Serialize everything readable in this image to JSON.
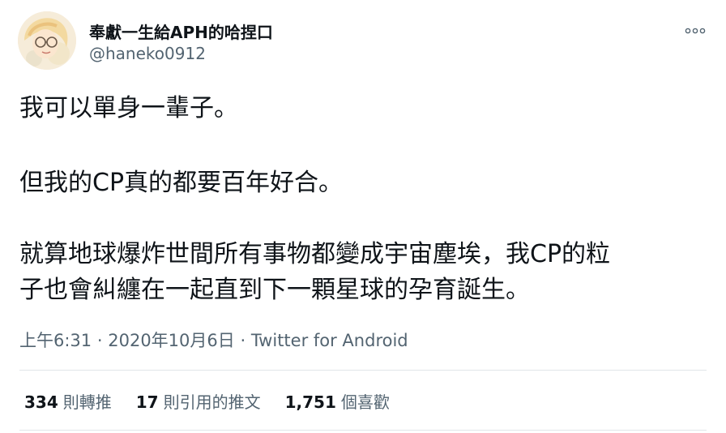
{
  "author": {
    "display_name": "奉獻一生給APH的哈捏口",
    "handle": "@haneko0912"
  },
  "header": {
    "more_icon": "more-horizontal-icon"
  },
  "tweet": {
    "lines": [
      "我可以單身一輩子。",
      "但我的CP真的都要百年好合。",
      "就算地球爆炸世間所有事物都變成宇宙塵埃，我CP的粒",
      "子也會糾纏在一起直到下一顆星球的孕育誕生。"
    ]
  },
  "meta": {
    "time": "上午6:31",
    "separator": "·",
    "date": "2020年10月6日",
    "source": "Twitter for Android"
  },
  "stats": {
    "retweets_count": "334",
    "retweets_label": "則轉推",
    "quotes_count": "17",
    "quotes_label": "則引用的推文",
    "likes_count": "1,751",
    "likes_label": "個喜歡"
  }
}
